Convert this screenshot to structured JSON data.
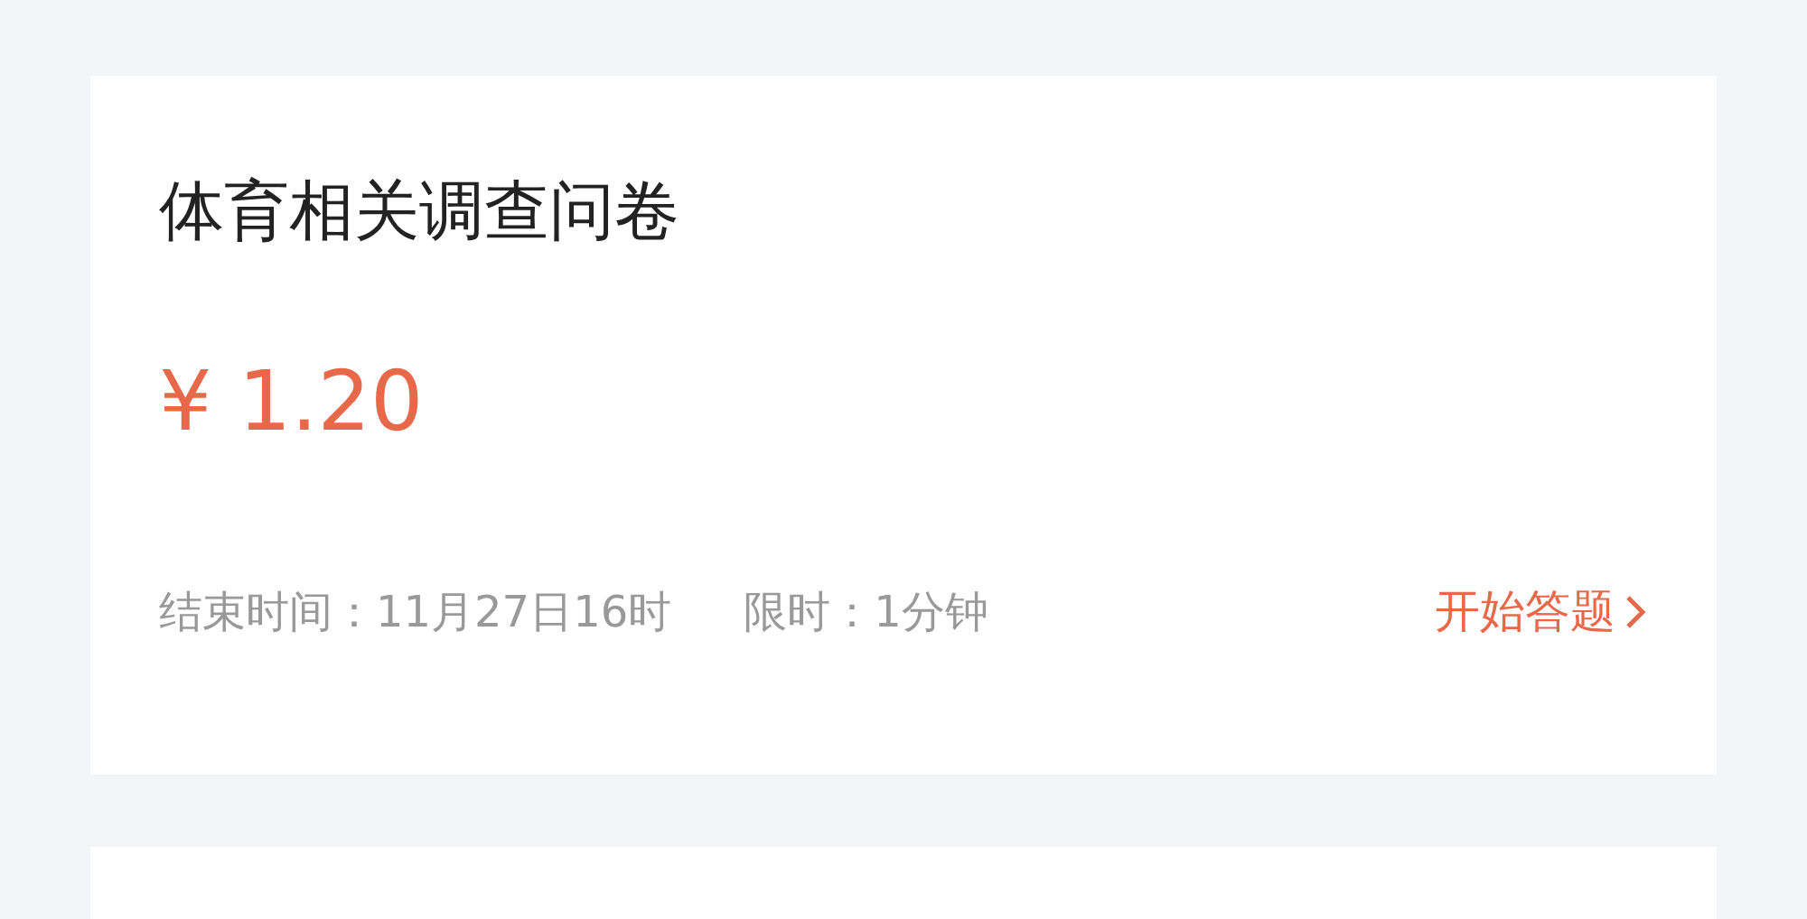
{
  "task": {
    "title": "体育相关调查问卷",
    "reward": "¥ 1.20",
    "end_time": "结束时间：11月27日16时",
    "time_limit": "限时：1分钟",
    "action": "开始答题"
  }
}
